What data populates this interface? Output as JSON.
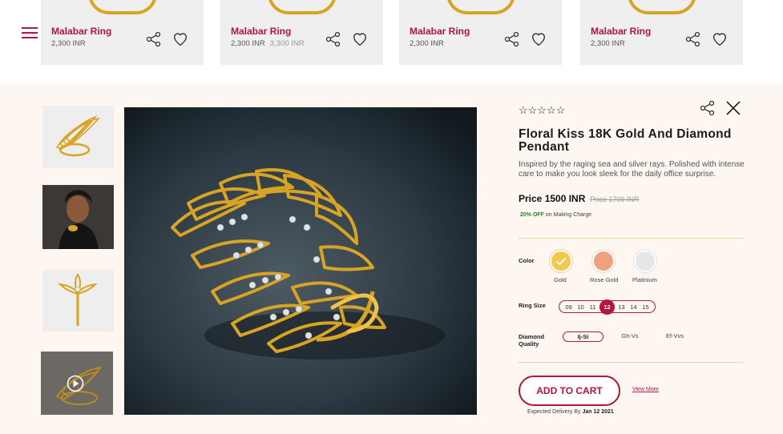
{
  "top_strip": {
    "cards": [
      {
        "name": "Malabar Ring",
        "price": "2,300 INR",
        "old_price": ""
      },
      {
        "name": "Malabar Ring",
        "price": "2,300 INR",
        "old_price": "3,300 INR"
      },
      {
        "name": "Malabar Ring",
        "price": "2,300 INR",
        "old_price": ""
      },
      {
        "name": "Malabar Ring",
        "price": "2,300 INR",
        "old_price": ""
      }
    ]
  },
  "product": {
    "rating_stars": "☆☆☆☆☆",
    "title": "Floral Kiss 18K Gold And Diamond Pendant",
    "description": "Inspired by the raging sea and silver rays. Polished with intense care to make you look sleek for the daily office surprise.",
    "price": "Price 1500 INR",
    "old_price": "Price 1700 INR",
    "discount_pct": "20% OFF",
    "discount_text": "on Making Charge",
    "color_label": "Color",
    "colors": [
      {
        "name": "Gold",
        "hex": "#f2c94c",
        "selected": true
      },
      {
        "name": "Rose Gold",
        "hex": "#f0a27f",
        "selected": false
      },
      {
        "name": "Platinium",
        "hex": "#e6e6e6",
        "selected": false
      }
    ],
    "ring_size_label": "Ring Size",
    "ring_sizes": [
      "09",
      "10",
      "11",
      "12",
      "13",
      "14",
      "15"
    ],
    "selected_ring_size": "12",
    "diamond_label_1": "Diamond",
    "diamond_label_2": "Quality",
    "diamond_qualities": [
      "Ij-Si",
      "Gh-Vs",
      "Ef-Vvs"
    ],
    "selected_quality": "Ij-Si",
    "add_to_cart": "ADD TO CART",
    "view_more": "View More",
    "delivery_text": "Expected Delivery By",
    "delivery_date": "Jan 12 2021"
  },
  "colors": {
    "brand": "#b0173a",
    "gold": "#d9a323",
    "panel_bg": "#fdf6f1"
  }
}
